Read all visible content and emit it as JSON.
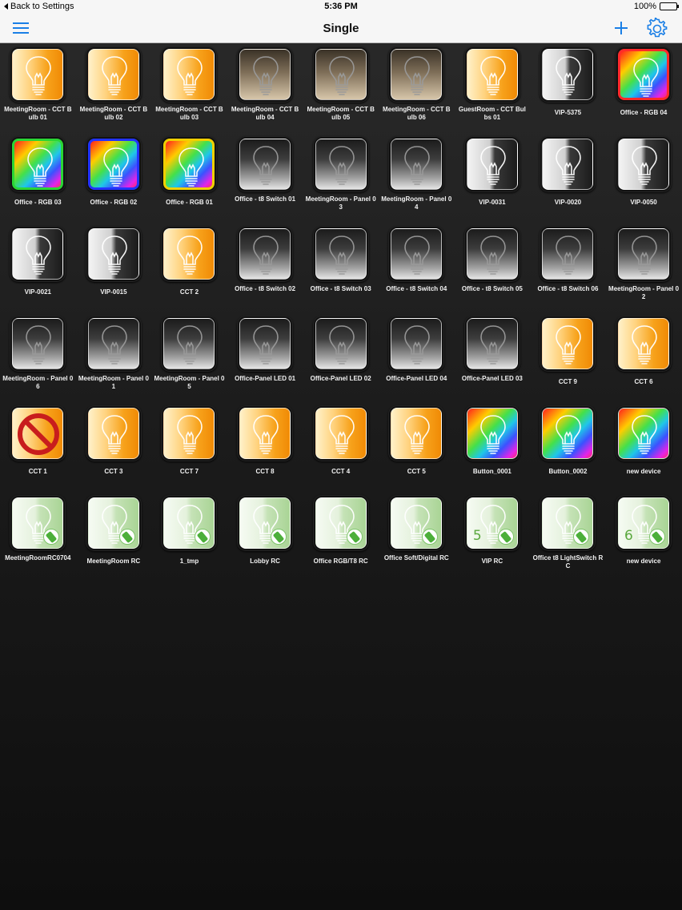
{
  "status_bar": {
    "back_label": "Back to Settings",
    "time": "5:36 PM",
    "battery": "100%"
  },
  "nav": {
    "title": "Single",
    "menu_icon": "hamburger-menu-icon",
    "add_icon": "plus-icon",
    "settings_icon": "gear-icon"
  },
  "colors": {
    "accent": "#1a7fe6",
    "label": "#f2f2f2",
    "cct": "#f7a21b",
    "remote": "#a9d495"
  },
  "devices": [
    {
      "label": "MeetingRoom - CCT Bulb 01",
      "icon": "cct-bulb-icon",
      "style": "cct"
    },
    {
      "label": "MeetingRoom - CCT Bulb 02",
      "icon": "cct-bulb-icon",
      "style": "cct"
    },
    {
      "label": "MeetingRoom - CCT Bulb 03",
      "icon": "cct-bulb-icon",
      "style": "cct"
    },
    {
      "label": "MeetingRoom - CCT Bulb 04",
      "icon": "cct-bulb-icon",
      "style": "cct-dim"
    },
    {
      "label": "MeetingRoom - CCT Bulb 05",
      "icon": "cct-bulb-icon",
      "style": "cct-dim"
    },
    {
      "label": "MeetingRoom - CCT Bulb 06",
      "icon": "cct-bulb-icon",
      "style": "cct-dim"
    },
    {
      "label": "GuestRoom - CCT Bulbs 01",
      "icon": "cct-bulb-icon",
      "style": "cct"
    },
    {
      "label": "VIP-5375",
      "icon": "mono-bulb-icon",
      "style": "mono"
    },
    {
      "label": "Office - RGB 04",
      "icon": "rgb-bulb-icon",
      "style": "rgb",
      "frame": "red"
    },
    {
      "label": "Office - RGB 03",
      "icon": "rgb-bulb-icon",
      "style": "rgb",
      "frame": "green"
    },
    {
      "label": "Office - RGB 02",
      "icon": "rgb-bulb-icon",
      "style": "rgb",
      "frame": "blue"
    },
    {
      "label": "Office - RGB 01",
      "icon": "rgb-bulb-icon",
      "style": "rgb",
      "frame": "yellow"
    },
    {
      "label": "Office - t8 Switch 01",
      "icon": "mono-bulb-icon",
      "style": "mono-dark"
    },
    {
      "label": "MeetingRoom - Panel 03",
      "icon": "mono-bulb-icon",
      "style": "mono-dark"
    },
    {
      "label": "MeetingRoom - Panel 04",
      "icon": "mono-bulb-icon",
      "style": "mono-dark"
    },
    {
      "label": "VIP-0031",
      "icon": "mono-bulb-icon",
      "style": "mono"
    },
    {
      "label": "VIP-0020",
      "icon": "mono-bulb-icon",
      "style": "mono"
    },
    {
      "label": "VIP-0050",
      "icon": "mono-bulb-icon",
      "style": "mono"
    },
    {
      "label": "VIP-0021",
      "icon": "mono-bulb-icon",
      "style": "mono"
    },
    {
      "label": "VIP-0015",
      "icon": "mono-bulb-icon",
      "style": "mono"
    },
    {
      "label": "CCT 2",
      "icon": "cct-bulb-icon",
      "style": "cct"
    },
    {
      "label": "Office - t8 Switch 02",
      "icon": "mono-bulb-icon",
      "style": "mono-dark"
    },
    {
      "label": "Office - t8 Switch 03",
      "icon": "mono-bulb-icon",
      "style": "mono-dark"
    },
    {
      "label": "Office - t8 Switch 04",
      "icon": "mono-bulb-icon",
      "style": "mono-dark"
    },
    {
      "label": "Office - t8 Switch 05",
      "icon": "mono-bulb-icon",
      "style": "mono-dark"
    },
    {
      "label": "Office - t8 Switch 06",
      "icon": "mono-bulb-icon",
      "style": "mono-dark"
    },
    {
      "label": "MeetingRoom - Panel 02",
      "icon": "mono-bulb-icon",
      "style": "mono-dark"
    },
    {
      "label": "MeetingRoom - Panel 06",
      "icon": "mono-bulb-icon",
      "style": "mono-dark"
    },
    {
      "label": "MeetingRoom - Panel 01",
      "icon": "mono-bulb-icon",
      "style": "mono-dark"
    },
    {
      "label": "MeetingRoom - Panel 05",
      "icon": "mono-bulb-icon",
      "style": "mono-dark"
    },
    {
      "label": "Office-Panel LED 01",
      "icon": "mono-bulb-icon",
      "style": "mono-dark"
    },
    {
      "label": "Office-Panel LED 02",
      "icon": "mono-bulb-icon",
      "style": "mono-dark"
    },
    {
      "label": "Office-Panel LED 04",
      "icon": "mono-bulb-icon",
      "style": "mono-dark"
    },
    {
      "label": "Office-Panel LED 03",
      "icon": "mono-bulb-icon",
      "style": "mono-dark"
    },
    {
      "label": "CCT 9",
      "icon": "cct-bulb-icon",
      "style": "cct"
    },
    {
      "label": "CCT 6",
      "icon": "cct-bulb-icon",
      "style": "cct"
    },
    {
      "label": "CCT 1",
      "icon": "prohibited-icon",
      "style": "cct",
      "blocked": true
    },
    {
      "label": "CCT 3",
      "icon": "cct-bulb-icon",
      "style": "cct"
    },
    {
      "label": "CCT 7",
      "icon": "cct-bulb-icon",
      "style": "cct"
    },
    {
      "label": "CCT 8",
      "icon": "cct-bulb-icon",
      "style": "cct"
    },
    {
      "label": "CCT 4",
      "icon": "cct-bulb-icon",
      "style": "cct"
    },
    {
      "label": "CCT 5",
      "icon": "cct-bulb-icon",
      "style": "cct"
    },
    {
      "label": "Button_0001",
      "icon": "rgb-bulb-icon",
      "style": "rgb"
    },
    {
      "label": "Button_0002",
      "icon": "rgb-bulb-icon",
      "style": "rgb"
    },
    {
      "label": "new device",
      "icon": "rgb-bulb-icon",
      "style": "rgb"
    },
    {
      "label": "MeetingRoomRC0704",
      "icon": "remote-icon",
      "style": "remote"
    },
    {
      "label": "MeetingRoom RC",
      "icon": "remote-icon",
      "style": "remote"
    },
    {
      "label": "1_tmp",
      "icon": "remote-icon",
      "style": "remote"
    },
    {
      "label": "Lobby RC",
      "icon": "remote-icon",
      "style": "remote"
    },
    {
      "label": "Office RGB/T8 RC",
      "icon": "remote-icon",
      "style": "remote"
    },
    {
      "label": "Office Soft/Digital RC",
      "icon": "remote-icon",
      "style": "remote"
    },
    {
      "label": "VIP RC",
      "icon": "remote-icon",
      "style": "remote",
      "badge": "5"
    },
    {
      "label": "Office t8 LightSwitch RC",
      "icon": "remote-icon",
      "style": "remote"
    },
    {
      "label": "new device",
      "icon": "remote-icon",
      "style": "remote",
      "badge": "6"
    }
  ]
}
